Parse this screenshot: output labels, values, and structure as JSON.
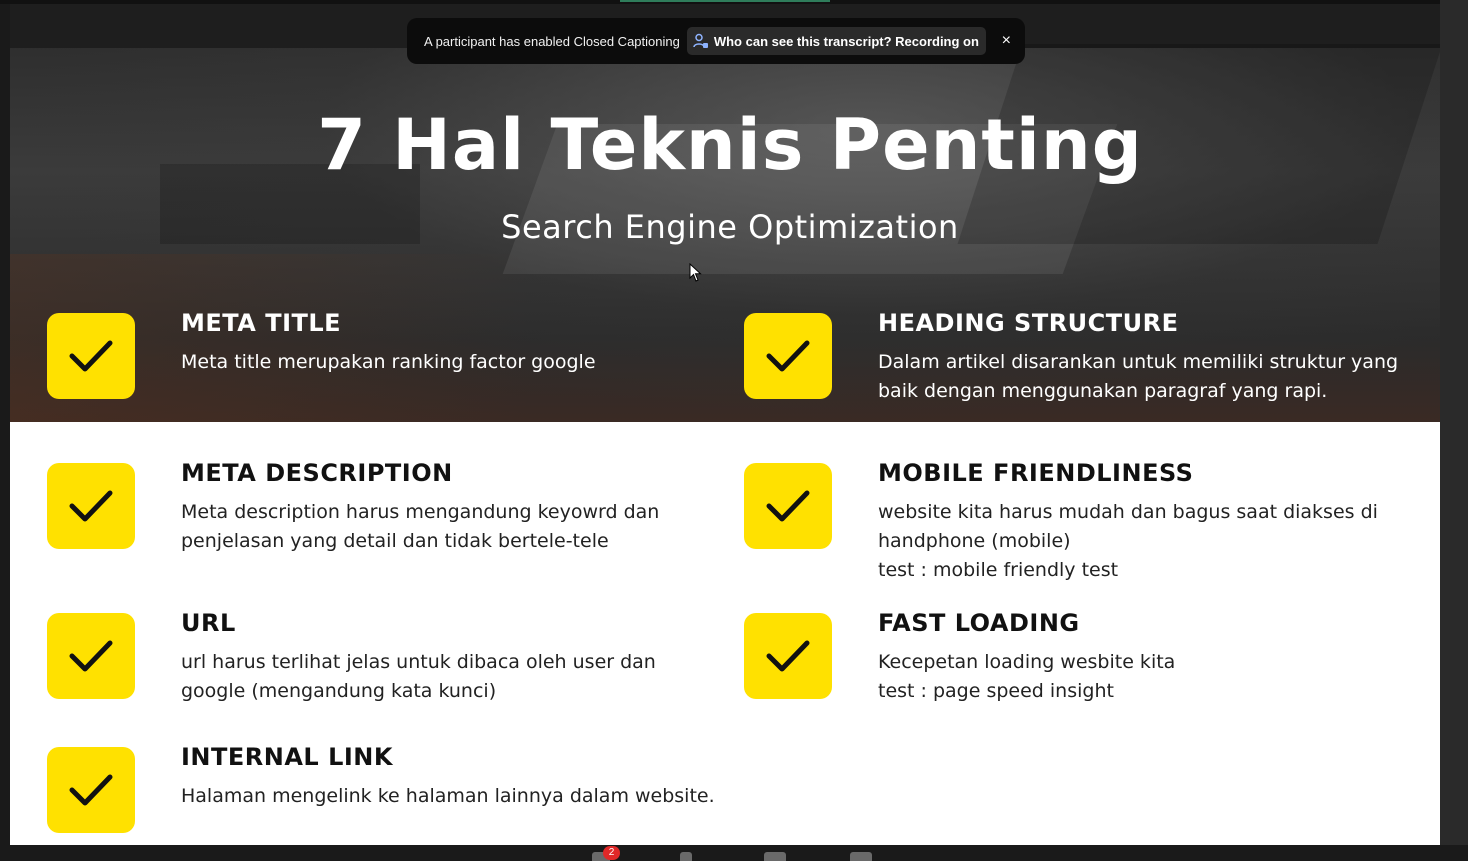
{
  "banner": {
    "message": "A participant has enabled Closed Captioning",
    "link_label": "Who can see this transcript? Recording on",
    "close_label": "×"
  },
  "slide": {
    "title": "7 Hal Teknis Penting",
    "subtitle": "Search Engine Optimization",
    "items": [
      {
        "title": "META TITLE",
        "lines": [
          "Meta title merupakan ranking factor google"
        ]
      },
      {
        "title": "HEADING STRUCTURE",
        "lines": [
          "Dalam artikel disarankan untuk memiliki struktur yang",
          "baik dengan menggunakan paragraf yang rapi."
        ]
      },
      {
        "title": "META DESCRIPTION",
        "lines": [
          "Meta description harus mengandung keyowrd dan",
          "penjelasan yang detail dan tidak bertele-tele"
        ]
      },
      {
        "title": "MOBILE FRIENDLINESS",
        "lines": [
          "website kita harus mudah dan bagus saat diakses di",
          "handphone (mobile)",
          "test : mobile friendly test"
        ]
      },
      {
        "title": "URL",
        "lines": [
          "url harus terlihat jelas untuk dibaca oleh user dan",
          "google (mengandung kata kunci)"
        ]
      },
      {
        "title": "FAST LOADING",
        "lines": [
          "Kecepetan loading wesbite kita",
          "test : page speed insight"
        ]
      },
      {
        "title": "INTERNAL LINK",
        "lines": [
          "Halaman mengelink ke halaman lainnya dalam website."
        ]
      }
    ]
  },
  "toolbar": {
    "chat_badge": "2"
  },
  "colors": {
    "check_box": "#ffe100",
    "banner_bg": "#0c0c0c",
    "badge": "#e02828"
  }
}
